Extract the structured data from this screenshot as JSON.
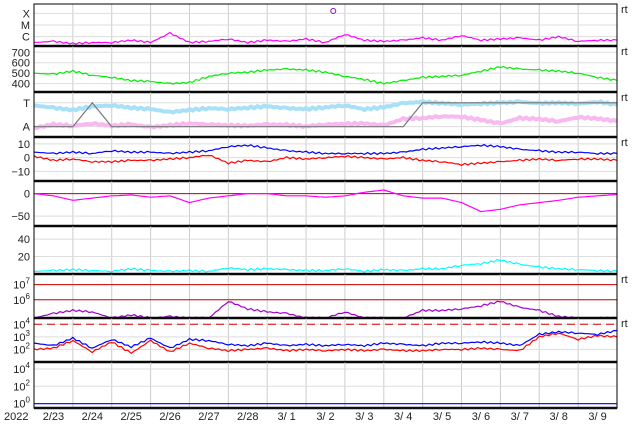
{
  "chart_data": {
    "type": "line",
    "title": "",
    "x_start_label": "2022",
    "x_ticks": [
      "2/23",
      "2/24",
      "2/25",
      "2/26",
      "2/27",
      "2/28",
      "3/ 1",
      "3/ 2",
      "3/ 3",
      "3/ 4",
      "3/ 5",
      "3/ 6",
      "3/ 7",
      "3/ 8",
      "3/ 9"
    ],
    "xlim_days": [
      0,
      15
    ],
    "right_tag": "rt",
    "panels": [
      {
        "id": "xray",
        "ylim": [
          -0.8,
          2.8
        ],
        "ticks": [
          {
            "v": 2,
            "l": "X"
          },
          {
            "v": 1,
            "l": "M"
          },
          {
            "v": 0,
            "l": "C"
          }
        ],
        "rt": true,
        "log": false,
        "series": [
          {
            "name": "xray-flux",
            "color": "#ff00ff",
            "values": [
              -0.5,
              -0.4,
              -0.6,
              -0.5,
              -0.5,
              -0.3,
              -0.5,
              0.3,
              -0.5,
              -0.4,
              -0.2,
              -0.5,
              -0.3,
              -0.4,
              -0.2,
              -0.5,
              0.2,
              -0.3,
              -0.4,
              -0.3,
              -0.1,
              -0.3,
              0.1,
              -0.3,
              -0.2,
              -0.1,
              -0.3,
              0,
              -0.4,
              -0.3,
              -0.3
            ]
          }
        ],
        "marker": {
          "day": 7.7,
          "value": 2.2
        }
      },
      {
        "id": "speed",
        "ylim": [
          320,
          760
        ],
        "ticks": [
          {
            "v": 700,
            "l": "700"
          },
          {
            "v": 600,
            "l": "600"
          },
          {
            "v": 500,
            "l": "500"
          },
          {
            "v": 400,
            "l": "400"
          }
        ],
        "rt": true,
        "series": [
          {
            "name": "solar-wind-speed",
            "color": "#00ee00",
            "values": [
              500,
              490,
              520,
              480,
              460,
              430,
              420,
              400,
              410,
              470,
              500,
              510,
              530,
              540,
              530,
              510,
              470,
              440,
              400,
              430,
              460,
              470,
              480,
              520,
              560,
              540,
              530,
              520,
              500,
              460,
              430
            ]
          }
        ]
      },
      {
        "id": "temp-density",
        "ylim": [
          0,
          10
        ],
        "ticks": [
          {
            "v": 7.6,
            "l": "T"
          },
          {
            "v": 2.3,
            "l": "A"
          }
        ],
        "rt": true,
        "series": [
          {
            "name": "temperature",
            "color": "#a8e0f8",
            "values": [
              7,
              6.5,
              6,
              6.8,
              7,
              6.5,
              6.2,
              5.5,
              6,
              6.4,
              6.2,
              6.5,
              6.8,
              6.4,
              6.2,
              6.6,
              7,
              6.2,
              6.6,
              7.5,
              7.8,
              7.5,
              7.2,
              7.4,
              7.6,
              7.8,
              7.5,
              7.6,
              7.4,
              7.8,
              7.2
            ]
          },
          {
            "name": "density",
            "color": "#f8b8f0",
            "values": [
              2,
              2.8,
              2.5,
              3,
              2.5,
              2.8,
              2.2,
              2.6,
              3,
              2.8,
              2.6,
              2.5,
              2.8,
              2.7,
              2.4,
              2.8,
              2.9,
              3,
              2.6,
              4,
              4.2,
              4.6,
              4.5,
              3.8,
              3,
              4.2,
              4,
              3.5,
              4.4,
              4.1,
              3.5
            ]
          },
          {
            "name": "type-indicator",
            "color": "#777777",
            "values": [
              2.3,
              2.3,
              2.3,
              7.6,
              2.3,
              2.3,
              2.3,
              2.3,
              2.3,
              2.3,
              2.3,
              2.3,
              2.3,
              2.3,
              2.3,
              2.3,
              2.3,
              2.3,
              2.3,
              2.3,
              7.6,
              7.6,
              7.6,
              7.6,
              7.6,
              7.6,
              7.6,
              7.6,
              7.6,
              7.6,
              7.6
            ]
          }
        ]
      },
      {
        "id": "imf",
        "ylim": [
          -17,
          15
        ],
        "ticks": [
          {
            "v": 10,
            "l": "10"
          },
          {
            "v": 0,
            "l": "0"
          },
          {
            "v": -10,
            "l": "−10"
          }
        ],
        "rt": true,
        "series": [
          {
            "name": "bt",
            "color": "#0000ff",
            "values": [
              4,
              3,
              4,
              3,
              5,
              4,
              4,
              3,
              4,
              5,
              8,
              9,
              7,
              5,
              4,
              3,
              3,
              3,
              3,
              4,
              6,
              7,
              8,
              9,
              8,
              6,
              5,
              4,
              4,
              3,
              3
            ]
          },
          {
            "name": "bz",
            "color": "#ff0000",
            "values": [
              1,
              -2,
              -1,
              -3,
              -3,
              -2,
              -2,
              -1,
              0,
              2,
              -4,
              -2,
              -3,
              0,
              -1,
              0,
              1,
              0,
              -1,
              0,
              -2,
              -3,
              -5,
              -4,
              -3,
              -2,
              -1,
              -2,
              -1,
              -1,
              -2
            ]
          }
        ]
      },
      {
        "id": "dst",
        "ylim": [
          -72,
          28
        ],
        "ticks": [
          {
            "v": 0,
            "l": "0"
          },
          {
            "v": -50,
            "l": "−50"
          }
        ],
        "rt": false,
        "series": [
          {
            "name": "dst",
            "color": "#ff00ff",
            "values": [
              0,
              -5,
              -15,
              -10,
              -5,
              -3,
              -8,
              -5,
              -20,
              -10,
              -5,
              0,
              0,
              -5,
              -5,
              -8,
              -5,
              3,
              8,
              -5,
              -10,
              -10,
              -20,
              -40,
              -35,
              -25,
              -20,
              -15,
              -8,
              -5,
              -2
            ]
          }
        ],
        "reference": 0
      },
      {
        "id": "kp",
        "ylim": [
          0,
          55
        ],
        "ticks": [
          {
            "v": 40,
            "l": "40"
          },
          {
            "v": 20,
            "l": "20"
          }
        ],
        "rt": false,
        "series": [
          {
            "name": "index",
            "color": "#00ffff",
            "values": [
              3,
              4,
              5,
              4,
              3,
              6,
              4,
              3,
              4,
              3,
              7,
              5,
              6,
              5,
              4,
              4,
              6,
              3,
              5,
              4,
              6,
              6,
              10,
              12,
              16,
              11,
              8,
              6,
              5,
              4,
              3
            ]
          }
        ]
      },
      {
        "id": "electron",
        "ylim": [
          4.8,
          7.7
        ],
        "ticks": [
          {
            "v": 7,
            "l": "7",
            "base": "10"
          },
          {
            "v": 6,
            "l": "6",
            "base": "10"
          }
        ],
        "rt": true,
        "log": true,
        "series": [
          {
            "name": "electron-flux",
            "color": "#a000d0",
            "values": [
              4.8,
              5.1,
              5.3,
              5.2,
              4.8,
              5.0,
              4.8,
              4.9,
              4.8,
              4.8,
              5.9,
              5.4,
              5.2,
              5.1,
              4.8,
              4.8,
              5.2,
              4.8,
              4.8,
              4.8,
              5.3,
              5.3,
              5.4,
              5.6,
              5.9,
              5.5,
              5.3,
              4.9,
              4.8,
              4.8,
              4.8
            ]
          }
        ],
        "reference": 6
      },
      {
        "id": "proton",
        "ylim": [
          1,
          4.5
        ],
        "ticks": [
          {
            "v": 4,
            "l": "4",
            "base": "10"
          },
          {
            "v": 3,
            "l": "3",
            "base": "10"
          },
          {
            "v": 2,
            "l": "2",
            "base": "10"
          }
        ],
        "rt": true,
        "log": true,
        "series": [
          {
            "name": "proton-blue",
            "color": "#0000ff",
            "values": [
              2.5,
              2.3,
              2.9,
              2.1,
              2.8,
              2.2,
              2.9,
              2.1,
              2.8,
              2.7,
              2.4,
              2.3,
              2.5,
              2.3,
              2.4,
              2.3,
              2.4,
              2.3,
              2.5,
              2.4,
              2.3,
              2.5,
              2.5,
              2.6,
              2.5,
              2.3,
              3.2,
              3.4,
              3.3,
              3.2,
              3.5
            ]
          },
          {
            "name": "proton-red",
            "color": "#ff0000",
            "values": [
              2,
              2.1,
              2.7,
              1.8,
              2.6,
              1.7,
              2.7,
              1.8,
              2.5,
              2.1,
              1.9,
              2,
              2.1,
              1.9,
              2,
              1.9,
              2,
              1.9,
              2,
              1.9,
              1.9,
              2,
              2,
              2.1,
              2,
              1.9,
              3,
              3.3,
              2.8,
              3.1,
              3.0
            ]
          }
        ],
        "reference": 4
      },
      {
        "id": "bottom",
        "ylim": [
          -0.5,
          4.8
        ],
        "ticks": [
          {
            "v": 4,
            "l": "4",
            "base": "10"
          },
          {
            "v": 2,
            "l": "2",
            "base": "10"
          },
          {
            "v": 0,
            "l": "0",
            "base": "10"
          }
        ],
        "rt": false,
        "log": true,
        "series": [
          {
            "name": "low-flux",
            "color": "#0000ff",
            "values": [
              0,
              0,
              0,
              0,
              0,
              0,
              0,
              0,
              0,
              0,
              0,
              0,
              0,
              0,
              0,
              0,
              0,
              0,
              0,
              0,
              0,
              0,
              0,
              0,
              0,
              0,
              0,
              0,
              0,
              0,
              0
            ]
          }
        ]
      }
    ]
  }
}
